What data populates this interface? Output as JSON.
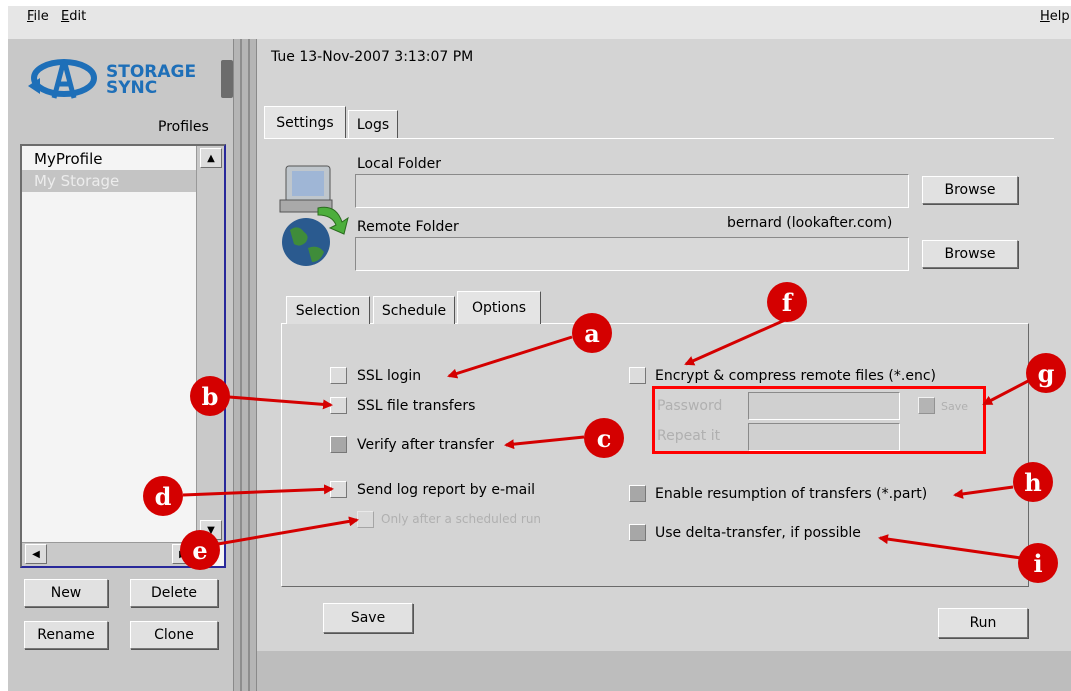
{
  "menu": {
    "file": "File",
    "edit": "Edit",
    "help": "Help"
  },
  "logo": {
    "line1": "STORAGE",
    "line2": "SYNC"
  },
  "profiles": {
    "header": "Profiles",
    "items": [
      "MyProfile",
      "My Storage"
    ]
  },
  "profile_buttons": {
    "new": "New",
    "delete": "Delete",
    "rename": "Rename",
    "clone": "Clone"
  },
  "timestamp": "Tue 13-Nov-2007 3:13:07 PM",
  "main_tabs": [
    "Settings",
    "Logs"
  ],
  "local_folder": {
    "label": "Local Folder",
    "value": "",
    "browse": "Browse"
  },
  "remote_folder": {
    "label": "Remote Folder",
    "account": "bernard (lookafter.com)",
    "value": "",
    "browse": "Browse"
  },
  "sub_tabs": [
    "Selection",
    "Schedule",
    "Options"
  ],
  "options": {
    "ssl_login": "SSL login",
    "ssl_file_transfers": "SSL file transfers",
    "verify_after_transfer": "Verify after transfer",
    "send_log_report": "Send log report by e-mail",
    "only_after_scheduled": "Only after a scheduled run",
    "encrypt_compress": "Encrypt & compress remote files (*.enc)",
    "password_label": "Password",
    "repeat_label": "Repeat it",
    "save_password": "Save",
    "enable_resumption": "Enable resumption of transfers (*.part)",
    "use_delta": "Use delta-transfer, if possible"
  },
  "bottom_buttons": {
    "save": "Save",
    "run": "Run"
  },
  "annotations": [
    "a",
    "b",
    "c",
    "d",
    "e",
    "f",
    "g",
    "h",
    "i"
  ],
  "colors": {
    "annotation": "#d40000",
    "highlight_box": "#ff0000",
    "logo_blue": "#1e6fb8"
  }
}
